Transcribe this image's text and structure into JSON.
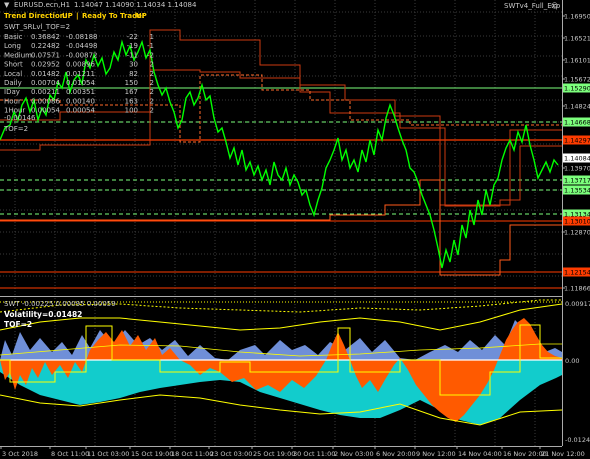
{
  "chart_header": {
    "symbol": "EURUSD.ecn,H1",
    "ohlc": "1.14047 1.14090 1.14034 1.14084"
  },
  "main_panel": {
    "trend_direction_label": "Trend Direction:",
    "trend_direction_value": "UP",
    "ready_to_trade_label": "Ready To Trade:",
    "ready_to_trade_value": "UP",
    "indicator_name": "SWT_SRLvl_TOF=2",
    "indicator_name_right": "SWTv4_Full_Exp",
    "smiley": "☺",
    "table_rows": [
      {
        "name": "Basic",
        "v1": "0.36842",
        "v2": "-0.08188",
        "v3": "-22",
        "v4": "1"
      },
      {
        "name": "Long",
        "v1": "0.22482",
        "v2": "-0.04498",
        "v3": "-19",
        "v4": "-1"
      },
      {
        "name": "Medium",
        "v1": "0.07571",
        "v2": "-0.00872",
        "v3": "-11",
        "v4": "-2"
      },
      {
        "name": "Short",
        "v1": "0.02952",
        "v2": "0.00896",
        "v3": "30",
        "v4": "2"
      },
      {
        "name": "Local",
        "v1": "0.01482",
        "v2": "0.01211",
        "v3": "82",
        "v4": "2"
      },
      {
        "name": "Daily",
        "v1": "0.00704",
        "v2": "0.01054",
        "v3": "150",
        "v4": "2"
      },
      {
        "name": "IDay",
        "v1": "0.00211",
        "v2": "0.00351",
        "v3": "167",
        "v4": "2"
      },
      {
        "name": "Hour",
        "v1": "0.00086",
        "v2": "0.00140",
        "v3": "163",
        "v4": "2"
      },
      {
        "name": "1Hour",
        "v1": "0.00054",
        "v2": "0.00054",
        "v3": "100",
        "v4": "2"
      }
    ],
    "extra_line": "-0.00146",
    "tof_label": "TOF=2"
  },
  "price_axis": [
    {
      "label": "1.16950",
      "style": "plain"
    },
    {
      "label": "1.16521",
      "style": "plain"
    },
    {
      "label": "1.16101",
      "style": "plain"
    },
    {
      "label": "1.15672",
      "style": "plain"
    },
    {
      "label": "1.15290",
      "style": "tag-green"
    },
    {
      "label": "1.14824",
      "style": "plain"
    },
    {
      "label": "1.14668",
      "style": "tag-green"
    },
    {
      "label": "1.14297",
      "style": "tag-red"
    },
    {
      "label": "1.14084",
      "style": "tag-white"
    },
    {
      "label": "1.13970",
      "style": "plain"
    },
    {
      "label": "1.13717",
      "style": "tag-green"
    },
    {
      "label": "1.13534",
      "style": "tag-green"
    },
    {
      "label": "1.13134",
      "style": "tag-green"
    },
    {
      "label": "1.13010",
      "style": "tag-red"
    },
    {
      "label": "1.12870",
      "style": "plain"
    },
    {
      "label": "1.12154",
      "style": "tag-red"
    },
    {
      "label": "1.11866",
      "style": "plain"
    }
  ],
  "sub_panel": {
    "header": "SWT -0.00225 0.00095 0.00059",
    "volatility": "Volatility=0.01482",
    "tof_label": "TOF=2",
    "axis": [
      "0.00917",
      "0.00",
      "-0.01247"
    ]
  },
  "time_axis": [
    "3 Oct 2018",
    "8 Oct 11:00",
    "11 Oct 03:00",
    "15 Oct 19:00",
    "18 Oct 11:00",
    "23 Oct 03:00",
    "25 Oct 19:00",
    "30 Oct 11:00",
    "2 Nov 03:00",
    "6 Nov 20:00",
    "9 Nov 12:00",
    "14 Nov 04:00",
    "16 Nov 20:00",
    "21 Nov 12:00"
  ],
  "colors": {
    "background": "#000000",
    "price_line": "#00ff00",
    "resistance": "#ff4500",
    "support_green": "#7cff7c",
    "yellow": "#ffff00",
    "hist_orange": "#ff5a00",
    "hist_blue": "#6f8fd8",
    "hist_cyan": "#12cccc"
  }
}
